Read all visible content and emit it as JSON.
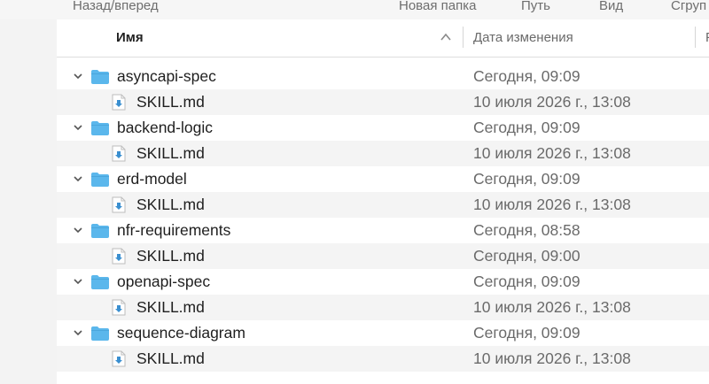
{
  "toolbar": {
    "back_forward": "Назад/вперед",
    "new_folder": "Новая папка",
    "path": "Путь",
    "view": "Вид",
    "group": "Сгруп"
  },
  "header": {
    "name_col": "Имя",
    "date_col": "Дата изменения",
    "right_col": "Р"
  },
  "items": [
    {
      "name": "asyncapi-spec",
      "date": "Сегодня, 09:09",
      "child": {
        "name": "SKILL.md",
        "date": "10 июля 2026 г., 13:08"
      }
    },
    {
      "name": "backend-logic",
      "date": "Сегодня, 09:09",
      "child": {
        "name": "SKILL.md",
        "date": "10 июля 2026 г., 13:08"
      }
    },
    {
      "name": "erd-model",
      "date": "Сегодня, 09:09",
      "child": {
        "name": "SKILL.md",
        "date": "10 июля 2026 г., 13:08"
      }
    },
    {
      "name": "nfr-requirements",
      "date": "Сегодня, 08:58",
      "child": {
        "name": "SKILL.md",
        "date": "Сегодня, 09:00"
      }
    },
    {
      "name": "openapi-spec",
      "date": "Сегодня, 09:09",
      "child": {
        "name": "SKILL.md",
        "date": "10 июля 2026 г., 13:08"
      }
    },
    {
      "name": "sequence-diagram",
      "date": "Сегодня, 09:09",
      "child": {
        "name": "SKILL.md",
        "date": "10 июля 2026 г., 13:08"
      }
    }
  ],
  "colors": {
    "folder": "#5bb7ec",
    "zebra": "#f4f4f4",
    "muted_text": "#6a6a6a"
  }
}
